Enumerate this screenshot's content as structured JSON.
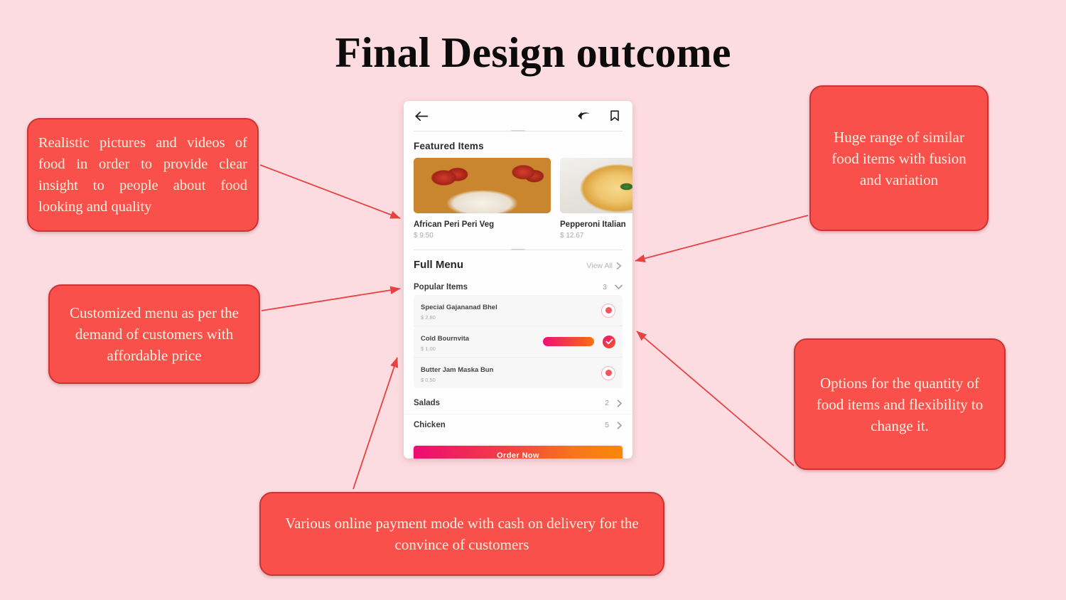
{
  "slide": {
    "title": "Final Design outcome",
    "background_color": "#FCDCE1",
    "accent_color": "#F9504B",
    "arrow_color": "#E8413F"
  },
  "callouts": [
    {
      "id": "realistic",
      "text": "Realistic pictures and videos of food in order to provide clear insight to people about food looking and quality"
    },
    {
      "id": "customized",
      "text": "Customized menu as per the demand of customers with affordable price"
    },
    {
      "id": "huge",
      "text": "Huge range of similar food items with fusion and variation"
    },
    {
      "id": "options",
      "text": "Options for the quantity of food items and flexibility to change it."
    },
    {
      "id": "payment",
      "text": "Various online payment mode with cash on delivery for the convince of customers"
    }
  ],
  "phone": {
    "topbar": {
      "back_icon": "arrow-left-icon",
      "share_icon": "share-arrow-icon",
      "bookmark_icon": "bookmark-icon"
    },
    "featured": {
      "heading": "Featured Items",
      "items": [
        {
          "name": "African Peri Peri Veg",
          "price": "$ 9.50",
          "image": "pizza-veg-photo"
        },
        {
          "name": "Pepperoni Italian",
          "price": "$ 12.67",
          "image": "pizza-pepperoni-photo"
        }
      ]
    },
    "full_menu": {
      "heading": "Full Menu",
      "view_all_label": "View All",
      "categories": [
        {
          "name": "Popular Items",
          "count": "3",
          "state": "expanded"
        },
        {
          "name": "Salads",
          "count": "2",
          "state": "collapsed"
        },
        {
          "name": "Chicken",
          "count": "5",
          "state": "collapsed"
        }
      ],
      "popular_items": [
        {
          "name": "Special Gajananad Bhel",
          "price": "$ 2.80",
          "control": "add"
        },
        {
          "name": "Cold Bournvita",
          "price": "$ 1.00",
          "control": "quantity-selected"
        },
        {
          "name": "Butter Jam Maska Bun",
          "price": "$ 0.50",
          "control": "add"
        }
      ]
    },
    "order_button_label": "Order Now"
  }
}
